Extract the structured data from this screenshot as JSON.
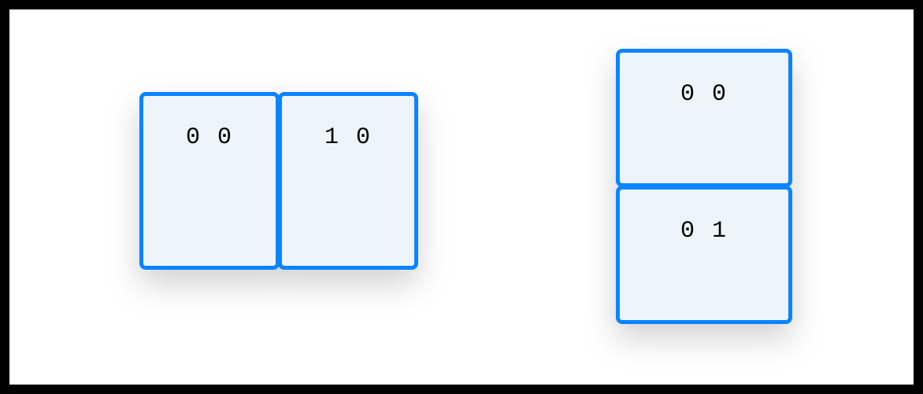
{
  "diagram": {
    "groups": [
      {
        "orientation": "horizontal",
        "cells": [
          {
            "label": "0 0"
          },
          {
            "label": "1 0"
          }
        ]
      },
      {
        "orientation": "vertical",
        "cells": [
          {
            "label": "0 0"
          },
          {
            "label": "0 1"
          }
        ]
      }
    ]
  },
  "colors": {
    "border": "#0a84ff",
    "cell_bg": "#eef5fa",
    "canvas_bg": "#ffffff",
    "outer_bg": "#000000"
  }
}
